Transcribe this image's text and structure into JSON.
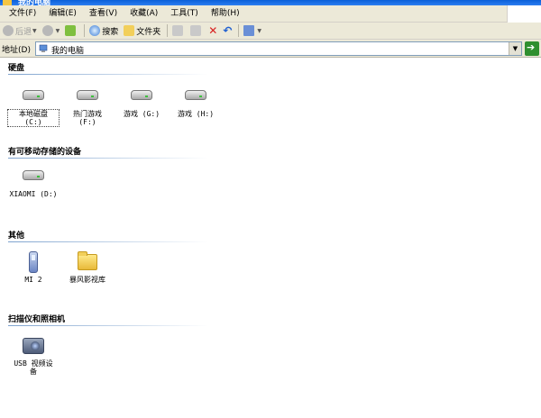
{
  "window": {
    "title": "我的电脑"
  },
  "menu": [
    "文件(F)",
    "编辑(E)",
    "查看(V)",
    "收藏(A)",
    "工具(T)",
    "帮助(H)"
  ],
  "toolbar": {
    "back_label": "后退",
    "search_label": "搜索",
    "folders_label": "文件夹"
  },
  "address": {
    "label": "地址(D)",
    "value": "我的电脑"
  },
  "groups": {
    "hard_disks": {
      "title": "硬盘",
      "items": [
        {
          "label": "本地磁盘\n(C:)",
          "icon": "hard-drive-icon"
        },
        {
          "label": "热门游戏\n(F:)",
          "icon": "hard-drive-icon"
        },
        {
          "label": "游戏 (G:)",
          "icon": "hard-drive-icon"
        },
        {
          "label": "游戏 (H:)",
          "icon": "hard-drive-icon"
        }
      ]
    },
    "removable": {
      "title": "有可移动存储的设备",
      "items": [
        {
          "label": "XIAOMI (D:)",
          "icon": "removable-drive-icon"
        }
      ]
    },
    "other": {
      "title": "其他",
      "items": [
        {
          "label": "MI 2",
          "icon": "phone-icon"
        },
        {
          "label": "暴风影视库",
          "icon": "folder-icon"
        }
      ]
    },
    "scanners": {
      "title": "扫描仪和照相机",
      "items": [
        {
          "label": "USB 视频设\n备",
          "icon": "camera-icon"
        }
      ]
    }
  }
}
